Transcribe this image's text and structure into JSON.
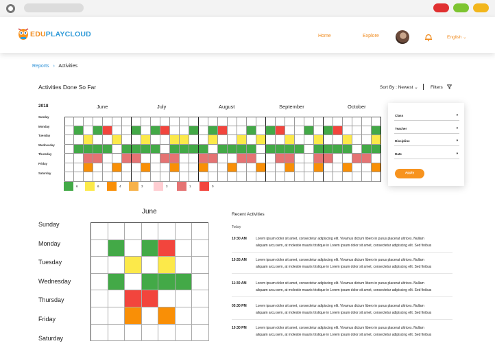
{
  "browser": {
    "dot_colors": [
      "#e03030",
      "#7dc430",
      "#f2b61c"
    ]
  },
  "header": {
    "logo": {
      "part1": "EDU",
      "part2": "PLAYCLOUD",
      "colors": [
        "#f08a1c",
        "#2f9ad8"
      ]
    },
    "nav": [
      "Home",
      "Explore"
    ],
    "language": "English ⌄",
    "icons": [
      "owl-logo-icon",
      "avatar",
      "bell-icon"
    ]
  },
  "breadcrumb": {
    "root": "Reports",
    "separator": "›",
    "current": "Activities"
  },
  "section": {
    "title": "Activities Done So Far",
    "sort_label": "Sort By : Newest ⌄",
    "filters_label": "Filters",
    "filter_icon": "funnel-icon"
  },
  "heatmap": {
    "year": "2018",
    "months": [
      "June",
      "July",
      "August",
      "September",
      "October"
    ],
    "days": [
      "Sunday",
      "Monday",
      "Tuesday",
      "Wednesday",
      "Thursday",
      "Friday",
      "Saturday"
    ],
    "weeks_per_month": [
      7,
      7,
      7,
      6,
      6
    ],
    "colors": {
      "G": "#43a947",
      "Y": "#fce94a",
      "O": "#f98f06",
      "L": "#f7b24a",
      "P": "#ffcdd2",
      "R": "#e57373",
      "D": "#f2453d",
      "": "#ffffff"
    },
    "rows": [
      "",
      "·G·GD··G·GD··G·GD··G·GD··G·GD···G·GD·",
      "··Y··Y··Y··YY··Y··Y·Y··Y··Y··Y··Y··Y·",
      "·GGGG·GGGG·GGGG·GGGG·GGGG·GGGG·GGGG·G",
      "··RR··RR··RR··RR··RR··RR··RR··RR··RR··",
      "··O··O··O··O··O··O··O··O··O··O··O··O",
      ""
    ]
  },
  "legend": [
    {
      "color": "#43a947",
      "value": "6"
    },
    {
      "color": "#fce94a",
      "value": "6"
    },
    {
      "color": "#f98f06",
      "value": "4"
    },
    {
      "color": "#f7b24a",
      "value": "3"
    },
    {
      "color": "#ffcdd2",
      "value": "3"
    },
    {
      "color": "#e57373",
      "value": "1"
    },
    {
      "color": "#f2453d",
      "value": "0"
    }
  ],
  "filter_panel": {
    "fields": [
      "Class",
      "Teacher",
      "Discipline",
      "Date"
    ],
    "caret": "▾",
    "apply": "Apply"
  },
  "june": {
    "title": "June",
    "days": [
      "Sunday",
      "Monday",
      "Tuesday",
      "Wednesday",
      "Thursday",
      "Friday",
      "Saturday"
    ],
    "cells": [
      [
        "",
        "",
        "",
        "",
        "",
        "",
        ""
      ],
      [
        "",
        "G",
        "",
        "G",
        "D",
        "",
        ""
      ],
      [
        "",
        "",
        "Y",
        "",
        "Y",
        "",
        ""
      ],
      [
        "",
        "G",
        "",
        "G",
        "G",
        "G",
        ""
      ],
      [
        "",
        "",
        "D",
        "D",
        "",
        "",
        ""
      ],
      [
        "",
        "",
        "O",
        "",
        "O",
        "",
        ""
      ],
      [
        "",
        "",
        "",
        "",
        "",
        "",
        ""
      ]
    ]
  },
  "recent": {
    "title": "Recent Activities",
    "today": "Today",
    "items": [
      {
        "time": "10:30 AM",
        "line1": "Lorem ipsum dolor sit amet, consectetur adipiscing elit. Vivamus dictum libero in purus placerat ultrices. Nullam",
        "line2": "aliquam arcu sem, at molestie mauris tristique in Lorem ipsum dolor sit amet, consectetur adipiscing elit. Sed finibus"
      },
      {
        "time": "10:55 AM",
        "line1": "Lorem ipsum dolor sit amet, consectetur adipiscing elit. Vivamus dictum libero in purus placerat ultrices. Nullam",
        "line2": "aliquam arcu sem, at molestie mauris tristique in Lorem ipsum dolor sit amet, consectetur adipiscing elit. Sed finibus"
      },
      {
        "time": "11:30 AM",
        "line1": "Lorem ipsum dolor sit amet, consectetur adipiscing elit. Vivamus dictum libero in purus placerat ultrices. Nullam",
        "line2": "aliquam arcu sem, at molestie mauris tristique in Lorem ipsum dolor sit amet, consectetur adipiscing elit. Sed finibus"
      },
      {
        "time": "05:30 PM",
        "line1": "Lorem ipsum dolor sit amet, consectetur adipiscing elit. Vivamus dictum libero in purus placerat ultrices. Nullam",
        "line2": "aliquam arcu sem, at molestie mauris tristique in Lorem ipsum dolor sit amet, consectetur adipiscing elit. Sed finibus"
      },
      {
        "time": "10:30 PM",
        "line1": "Lorem ipsum dolor sit amet, consectetur adipiscing elit. Vivamus dictum libero in purus placerat ultrices. Nullam",
        "line2": "aliquam arcu sem, at molestie mauris tristique in Lorem ipsum dolor sit amet, consectetur adipiscing elit. Sed finibus"
      }
    ]
  }
}
